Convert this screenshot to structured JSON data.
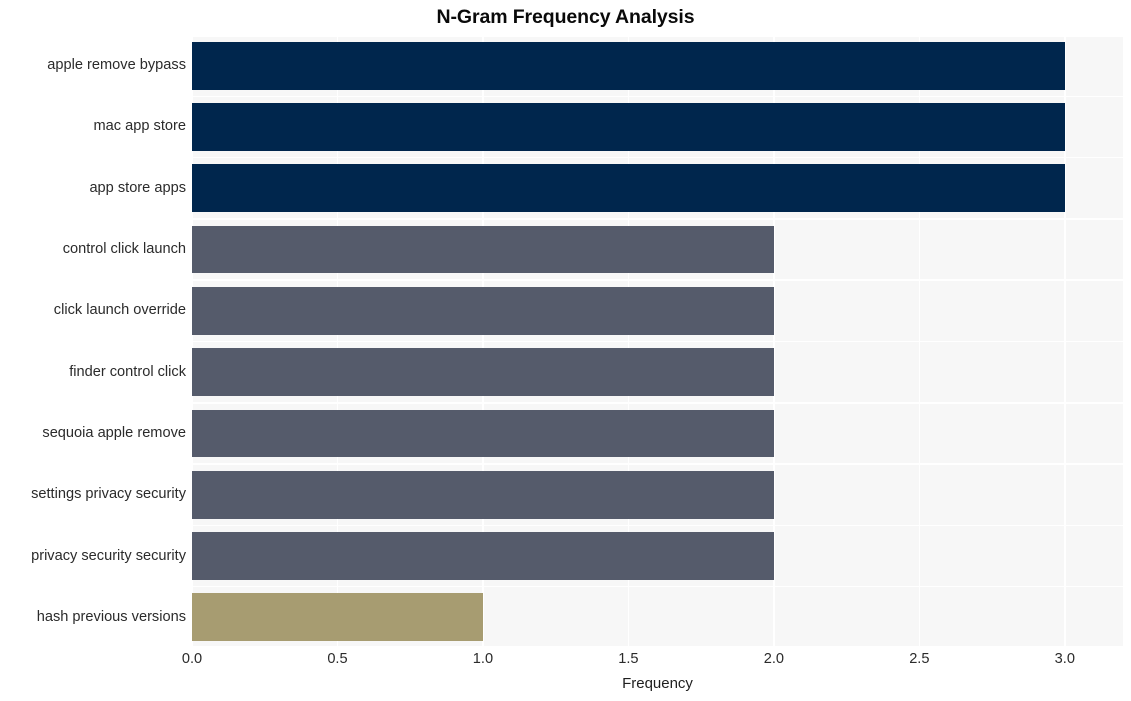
{
  "chart_data": {
    "type": "bar",
    "orientation": "horizontal",
    "title": "N-Gram Frequency Analysis",
    "xlabel": "Frequency",
    "ylabel": "",
    "xlim": [
      0.0,
      3.2
    ],
    "xticks": [
      "0.0",
      "0.5",
      "1.0",
      "1.5",
      "2.0",
      "2.5",
      "3.0"
    ],
    "xtick_values": [
      0.0,
      0.5,
      1.0,
      1.5,
      2.0,
      2.5,
      3.0
    ],
    "grid": true,
    "legend": "none",
    "categories": [
      "apple remove bypass",
      "mac app store",
      "app store apps",
      "control click launch",
      "click launch override",
      "finder control click",
      "sequoia apple remove",
      "settings privacy security",
      "privacy security security",
      "hash previous versions"
    ],
    "values": [
      3,
      3,
      3,
      2,
      2,
      2,
      2,
      2,
      2,
      1
    ],
    "bar_colors": [
      "#00264d",
      "#00264d",
      "#00264d",
      "#555b6b",
      "#555b6b",
      "#555b6b",
      "#555b6b",
      "#555b6b",
      "#555b6b",
      "#a79c71"
    ]
  },
  "style": {
    "plot_background": "#f7f7f7",
    "grid_color": "#ffffff",
    "figure_background": "#ffffff",
    "title_color": "#0a0a0a",
    "tick_color": "#2b2b2b"
  }
}
